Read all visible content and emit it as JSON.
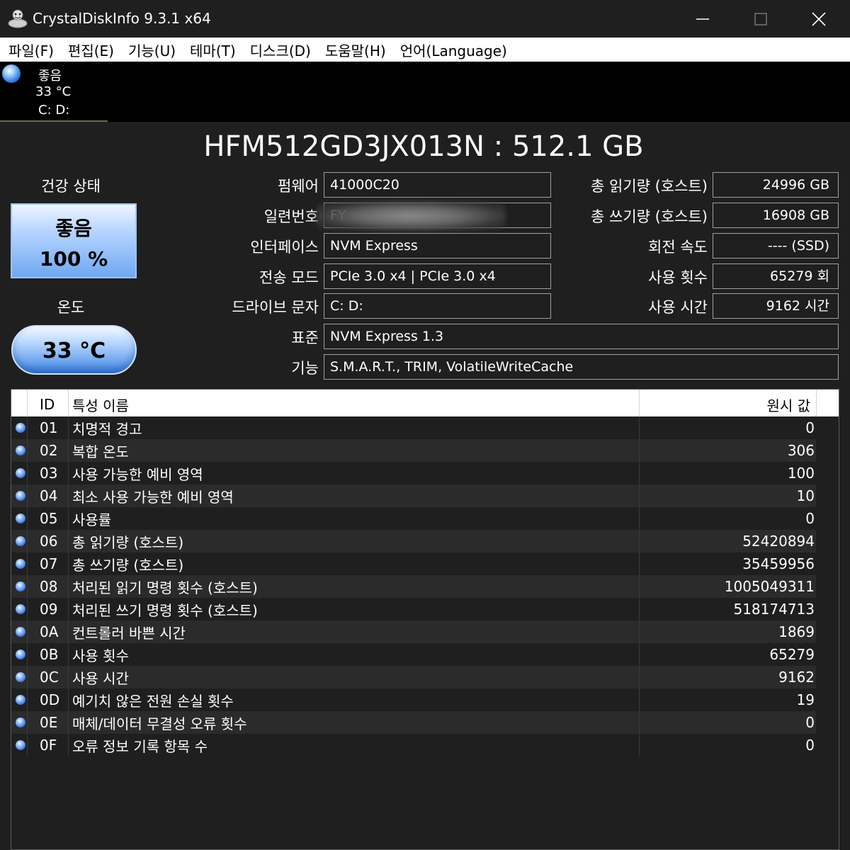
{
  "window": {
    "title": "CrystalDiskInfo 9.3.1 x64",
    "icon": "app-icon"
  },
  "menu": [
    "파일(F)",
    "편집(E)",
    "기능(U)",
    "테마(T)",
    "디스크(D)",
    "도움말(H)",
    "언어(Language)"
  ],
  "drive_tab": {
    "status": "좋음",
    "temperature": "33 °C",
    "letters": "C: D:"
  },
  "model": "HFM512GD3JX013N : 512.1 GB",
  "health": {
    "label": "건강 상태",
    "status": "좋음",
    "percent": "100 %"
  },
  "temperature": {
    "label": "온도",
    "value": "33 °C"
  },
  "info": {
    "firmware_label": "펌웨어",
    "firmware": "41000C20",
    "serial_label": "일련번호",
    "serial": "FY",
    "interface_label": "인터페이스",
    "interface": "NVM Express",
    "transfer_label": "전송 모드",
    "transfer": "PCIe 3.0 x4 | PCIe 3.0 x4",
    "drive_letter_label": "드라이브 문자",
    "drive_letter": "C: D:",
    "standard_label": "표준",
    "standard": "NVM Express 1.3",
    "features_label": "기능",
    "features": "S.M.A.R.T., TRIM, VolatileWriteCache",
    "host_reads_label": "총 읽기량 (호스트)",
    "host_reads": "24996 GB",
    "host_writes_label": "총 쓰기량 (호스트)",
    "host_writes": "16908 GB",
    "rotation_label": "회전 속도",
    "rotation": "---- (SSD)",
    "power_count_label": "사용 횟수",
    "power_count": "65279 회",
    "power_hours_label": "사용 시간",
    "power_hours": "9162 시간"
  },
  "smart": {
    "headers": {
      "id": "ID",
      "name": "특성 이름",
      "raw": "원시 값"
    },
    "rows": [
      {
        "id": "01",
        "name": "치명적 경고",
        "raw": "0"
      },
      {
        "id": "02",
        "name": "복합 온도",
        "raw": "306"
      },
      {
        "id": "03",
        "name": "사용 가능한 예비 영역",
        "raw": "100"
      },
      {
        "id": "04",
        "name": "최소 사용 가능한 예비 영역",
        "raw": "10"
      },
      {
        "id": "05",
        "name": "사용률",
        "raw": "0"
      },
      {
        "id": "06",
        "name": "총 읽기량 (호스트)",
        "raw": "52420894"
      },
      {
        "id": "07",
        "name": "총 쓰기량 (호스트)",
        "raw": "35459956"
      },
      {
        "id": "08",
        "name": "처리된 읽기 명령 횟수 (호스트)",
        "raw": "1005049311"
      },
      {
        "id": "09",
        "name": "처리된 쓰기 명령 횟수 (호스트)",
        "raw": "518174713"
      },
      {
        "id": "0A",
        "name": "컨트롤러 바쁜 시간",
        "raw": "1869"
      },
      {
        "id": "0B",
        "name": "사용 횟수",
        "raw": "65279"
      },
      {
        "id": "0C",
        "name": "사용 시간",
        "raw": "9162"
      },
      {
        "id": "0D",
        "name": "예기치 않은 전원 손실 횟수",
        "raw": "19"
      },
      {
        "id": "0E",
        "name": "매체/데이터 무결성 오류 횟수",
        "raw": "0"
      },
      {
        "id": "0F",
        "name": "오류 정보 기록 항목 수",
        "raw": "0"
      }
    ]
  },
  "colors": {
    "background": "#1f1f1f",
    "good_blue": "#6fa8f2",
    "status_dot": "#2f7fe6"
  }
}
